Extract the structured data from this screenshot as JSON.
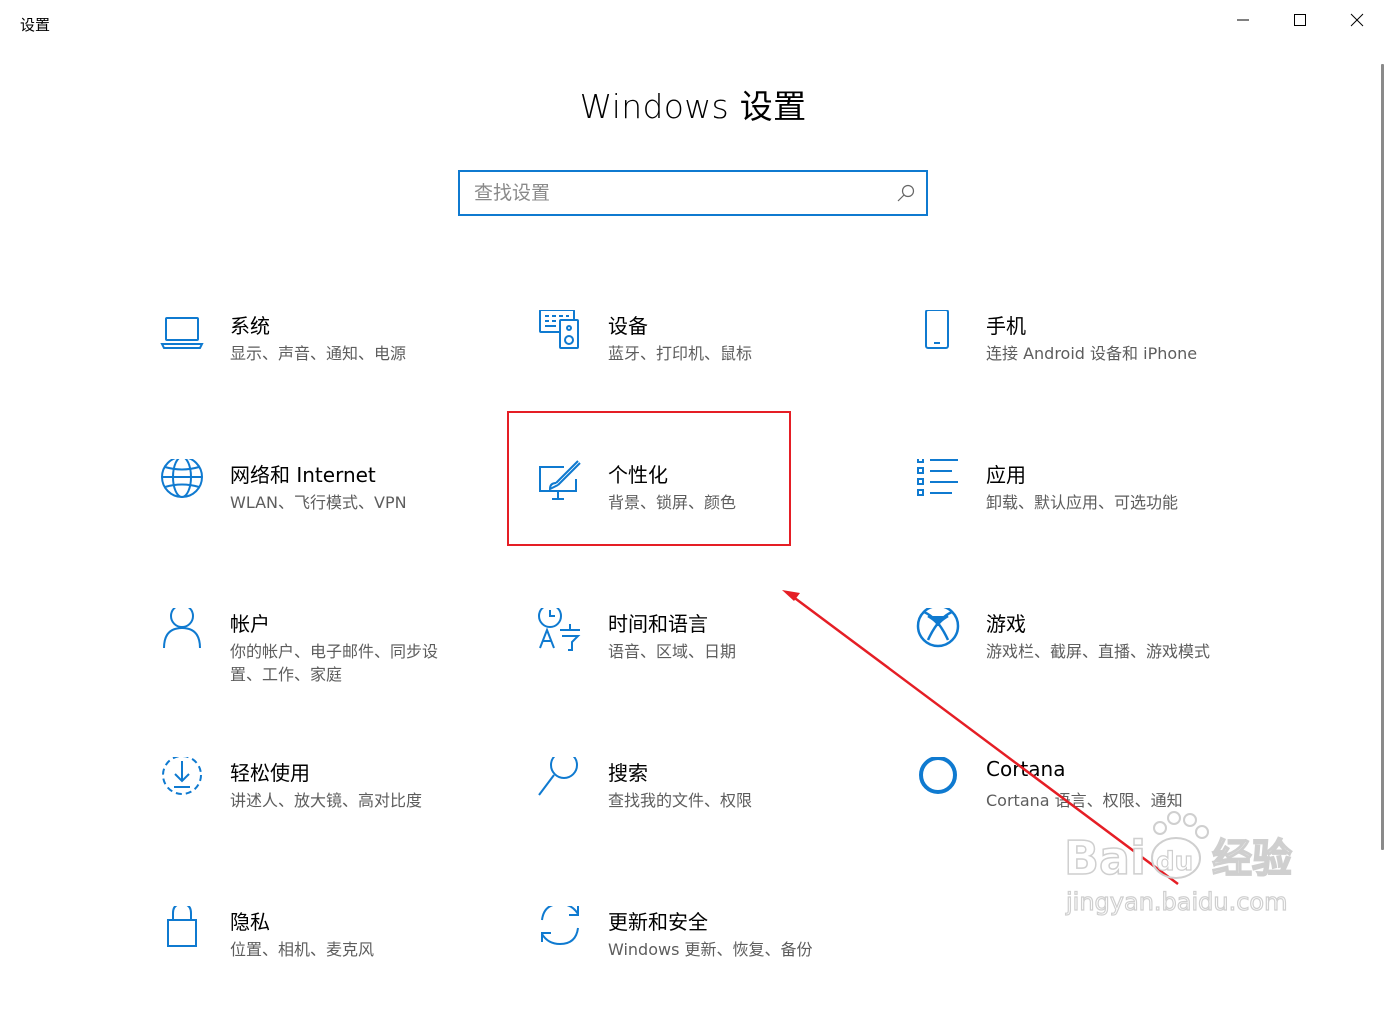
{
  "window": {
    "title": "设置",
    "controls": {
      "minimize": "minimize-icon",
      "maximize": "maximize-icon",
      "close": "close-icon"
    }
  },
  "header": {
    "title": "Windows 设置"
  },
  "search": {
    "placeholder": "查找设置",
    "value": ""
  },
  "tiles": [
    {
      "icon": "laptop-icon",
      "name": "系统",
      "desc": "显示、声音、通知、电源"
    },
    {
      "icon": "devices-icon",
      "name": "设备",
      "desc": "蓝牙、打印机、鼠标"
    },
    {
      "icon": "phone-icon",
      "name": "手机",
      "desc": "连接 Android 设备和 iPhone"
    },
    {
      "icon": "globe-icon",
      "name": "网络和 Internet",
      "desc": "WLAN、飞行模式、VPN"
    },
    {
      "icon": "personalization-icon",
      "name": "个性化",
      "desc": "背景、锁屏、颜色"
    },
    {
      "icon": "apps-icon",
      "name": "应用",
      "desc": "卸载、默认应用、可选功能"
    },
    {
      "icon": "person-icon",
      "name": "帐户",
      "desc": "你的帐户、电子邮件、同步设置、工作、家庭"
    },
    {
      "icon": "time-language-icon",
      "name": "时间和语言",
      "desc": "语音、区域、日期"
    },
    {
      "icon": "xbox-icon",
      "name": "游戏",
      "desc": "游戏栏、截屏、直播、游戏模式"
    },
    {
      "icon": "ease-of-access-icon",
      "name": "轻松使用",
      "desc": "讲述人、放大镜、高对比度"
    },
    {
      "icon": "search-icon",
      "name": "搜索",
      "desc": "查找我的文件、权限"
    },
    {
      "icon": "cortana-icon",
      "name": "Cortana",
      "desc": "Cortana 语言、权限、通知"
    },
    {
      "icon": "lock-icon",
      "name": "隐私",
      "desc": "位置、相机、麦克风"
    },
    {
      "icon": "update-icon",
      "name": "更新和安全",
      "desc": "Windows 更新、恢复、备份"
    }
  ],
  "annotation": {
    "color": "#e51e25",
    "highlighted_tile": "个性化"
  },
  "watermark": {
    "logo": "Bai du 经验",
    "url": "jingyan.baidu.com"
  },
  "colors": {
    "accent": "#0f7ad0",
    "desc_text": "#5d5d5d",
    "annotation_red": "#e51e25"
  }
}
